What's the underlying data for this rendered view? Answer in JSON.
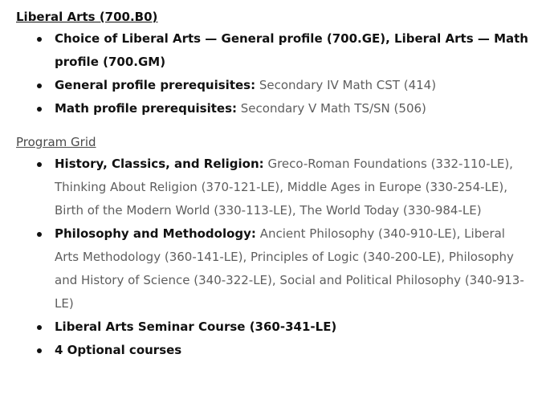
{
  "section1": {
    "title": "Liberal Arts (700.B0)",
    "items": [
      {
        "label": "Choice of Liberal Arts — General profile (700.GE), Liberal Arts — Math profile (700.GM)",
        "text": ""
      },
      {
        "label": "General profile prerequisites:",
        "text": " Secondary IV Math CST (414)"
      },
      {
        "label": "Math profile prerequisites:",
        "text": " Secondary V Math TS/SN (506)"
      }
    ]
  },
  "section2": {
    "title": "Program Grid",
    "items": [
      {
        "label": "History, Classics, and Religion:",
        "text": " Greco-Roman Foundations (332-110-LE), Thinking About Religion (370-121-LE), Middle Ages in Europe (330-254-LE), Birth of the Modern World (330-113-LE), The World Today (330-984-LE)"
      },
      {
        "label": "Philosophy and Methodology:",
        "text": " Ancient Philosophy (340-910-LE), Liberal Arts Methodology (360-141-LE), Principles of Logic (340-200-LE), Philosophy and History of Science (340-322-LE), Social and Political Philosophy (340-913-LE)"
      },
      {
        "label": "Liberal Arts Seminar Course (360-341-LE)",
        "text": ""
      },
      {
        "label": "4 Optional courses",
        "text": ""
      }
    ]
  }
}
